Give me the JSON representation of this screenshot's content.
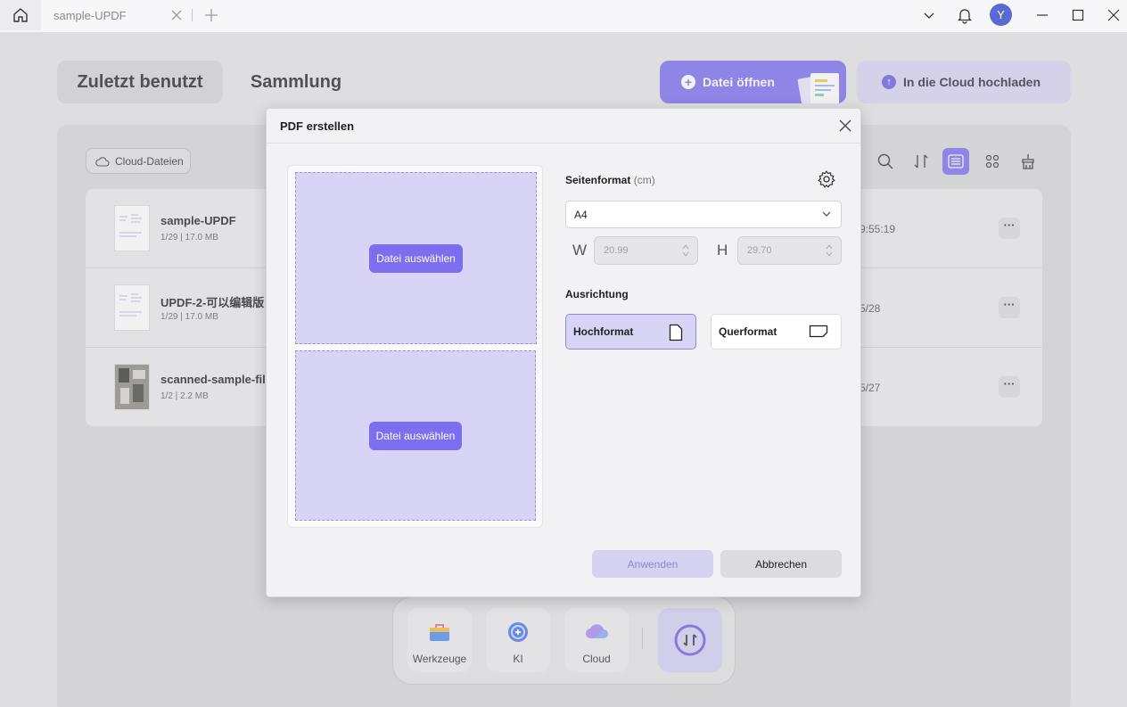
{
  "titlebar": {
    "tab_title": "sample-UPDF",
    "avatar_letter": "Y"
  },
  "header": {
    "tab_recent": "Zuletzt benutzt",
    "tab_collection": "Sammlung",
    "open_file": "Datei öffnen",
    "upload_cloud": "In die Cloud hochladen"
  },
  "main": {
    "cloud_files": "Cloud-Dateien",
    "files": [
      {
        "name": "sample-UPDF",
        "meta": "1/29 | 17.0 MB",
        "date": "9:55:19"
      },
      {
        "name": "UPDF-2-可以编辑版",
        "meta": "1/29 | 17.0 MB",
        "date": "5/28"
      },
      {
        "name": "scanned-sample-file",
        "meta": "1/2 | 2.2 MB",
        "date": "5/27"
      }
    ],
    "more_label": "···"
  },
  "dock": {
    "tools": "Werkzeuge",
    "ai": "KI",
    "cloud": "Cloud"
  },
  "dialog": {
    "title": "PDF erstellen",
    "choose_file_1": "Datei auswählen",
    "choose_file_2": "Datei auswählen",
    "page_format_label": "Seitenformat",
    "page_format_unit": "(cm)",
    "page_format_value": "A4",
    "width_label": "W",
    "width_value": "20.99",
    "height_label": "H",
    "height_value": "29.70",
    "orientation_label": "Ausrichtung",
    "portrait": "Hochformat",
    "landscape": "Querformat",
    "apply": "Anwenden",
    "cancel": "Abbrechen"
  },
  "colors": {
    "accent": "#7b6ff0",
    "accent_light": "#d7d4f5"
  }
}
